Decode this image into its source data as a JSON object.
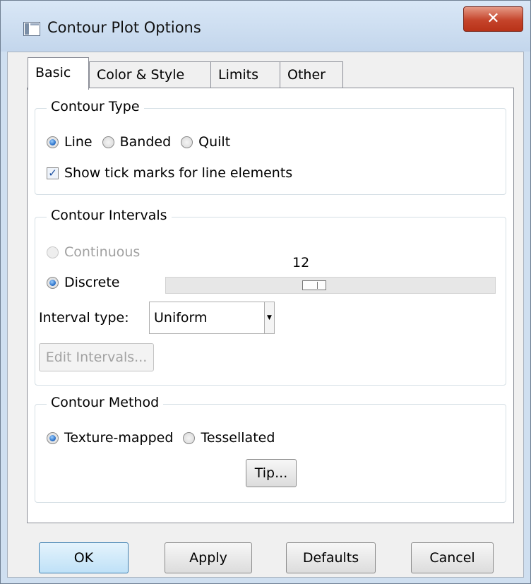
{
  "window": {
    "title": "Contour Plot Options",
    "close_glyph": "✕"
  },
  "tabs": [
    {
      "label": "Basic",
      "active": true
    },
    {
      "label": "Color & Style",
      "active": false
    },
    {
      "label": "Limits",
      "active": false
    },
    {
      "label": "Other",
      "active": false
    }
  ],
  "contour_type": {
    "legend": "Contour Type",
    "options": [
      "Line",
      "Banded",
      "Quilt"
    ],
    "selected": "Line",
    "show_tick_marks_label": "Show tick marks for line elements",
    "show_tick_marks_checked": true
  },
  "contour_intervals": {
    "legend": "Contour Intervals",
    "continuous_label": "Continuous",
    "discrete_label": "Discrete",
    "selected": "Discrete",
    "slider_value": "12",
    "slider_fraction": 0.5,
    "interval_type_label": "Interval type:",
    "interval_type_value": "Uniform",
    "edit_intervals_label": "Edit Intervals..."
  },
  "contour_method": {
    "legend": "Contour Method",
    "options": [
      "Texture-mapped",
      "Tessellated"
    ],
    "selected": "Texture-mapped",
    "tip_label": "Tip..."
  },
  "buttons": {
    "ok": "OK",
    "apply": "Apply",
    "defaults": "Defaults",
    "cancel": "Cancel"
  },
  "colors": {
    "accent": "#1f67c2",
    "close": "#c5442b",
    "default_button": "#bfe1f7"
  }
}
